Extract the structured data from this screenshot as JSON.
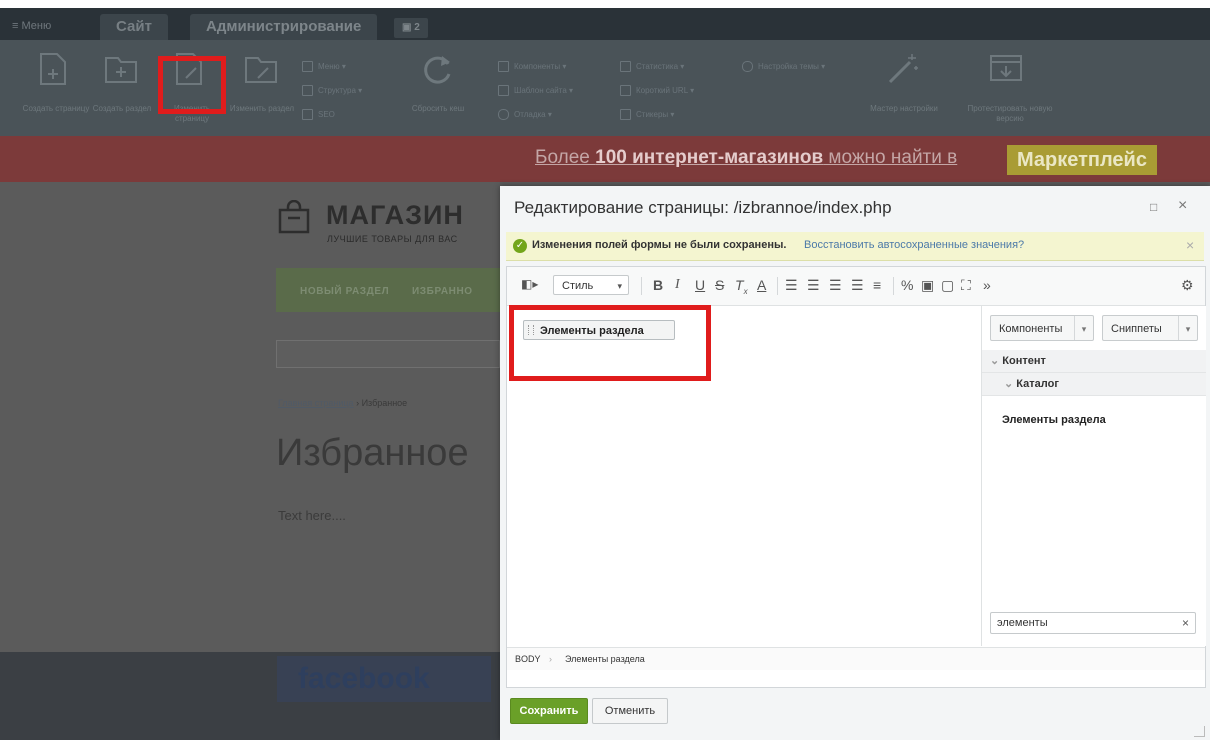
{
  "topbar": {
    "menu_label": "≡ Меню",
    "tab_site": "Сайт",
    "tab_admin": "Администрирование",
    "notify_count": "2"
  },
  "toolbar": {
    "create_page": "Создать страницу",
    "create_section": "Создать раздел",
    "edit_page": "Изменить страницу",
    "edit_section": "Изменить раздел",
    "menu": "Меню",
    "structure": "Структура",
    "seo": "SEO",
    "reset_cache": "Сбросить кеш",
    "components": "Компоненты",
    "site_template": "Шаблон сайта",
    "debug": "Отладка",
    "statistics": "Статистика",
    "short_url": "Короткий URL",
    "stickers": "Стикеры",
    "theme_settings": "Настройка темы",
    "wizard": "Мастер настройки",
    "test_version": "Протестировать новую версию"
  },
  "banner": {
    "text_pre": "Более ",
    "text_bold": "100 интернет-магазинов",
    "text_post": " можно найти в ",
    "badge": "Маркетплейс"
  },
  "shop": {
    "name": "МАГАЗИН",
    "subtitle": "ЛУЧШИЕ ТОВАРЫ ДЛЯ ВАС",
    "nav_new": "НОВЫЙ РАЗДЕЛ",
    "nav_fav": "ИЗБРАННО",
    "crumb_home": "Главная страница",
    "crumb_sep": "›",
    "crumb_current": "Избранное",
    "heading": "Избранное",
    "body_text": "Text here....",
    "footer_social": "facebook"
  },
  "dialog": {
    "title": "Редактирование страницы: /izbrannoe/index.php",
    "warn_message": "Изменения полей формы не были сохранены.",
    "warn_link": "Восстановить автосохраненные значения?",
    "style_select": "Стиль",
    "component_chip": "Элементы раздела",
    "side_components": "Компоненты",
    "side_snippets": "Сниппеты",
    "tree_content": "Контент",
    "tree_catalog": "Каталог",
    "tree_leaf": "Элементы раздела",
    "search_value": "элементы",
    "path_body": "BODY",
    "path_item": "Элементы раздела",
    "save": "Сохранить",
    "cancel": "Отменить"
  },
  "colors": {
    "highlight": "#e01c1c",
    "save_green": "#6aa028",
    "link_blue": "#4b79a8"
  }
}
